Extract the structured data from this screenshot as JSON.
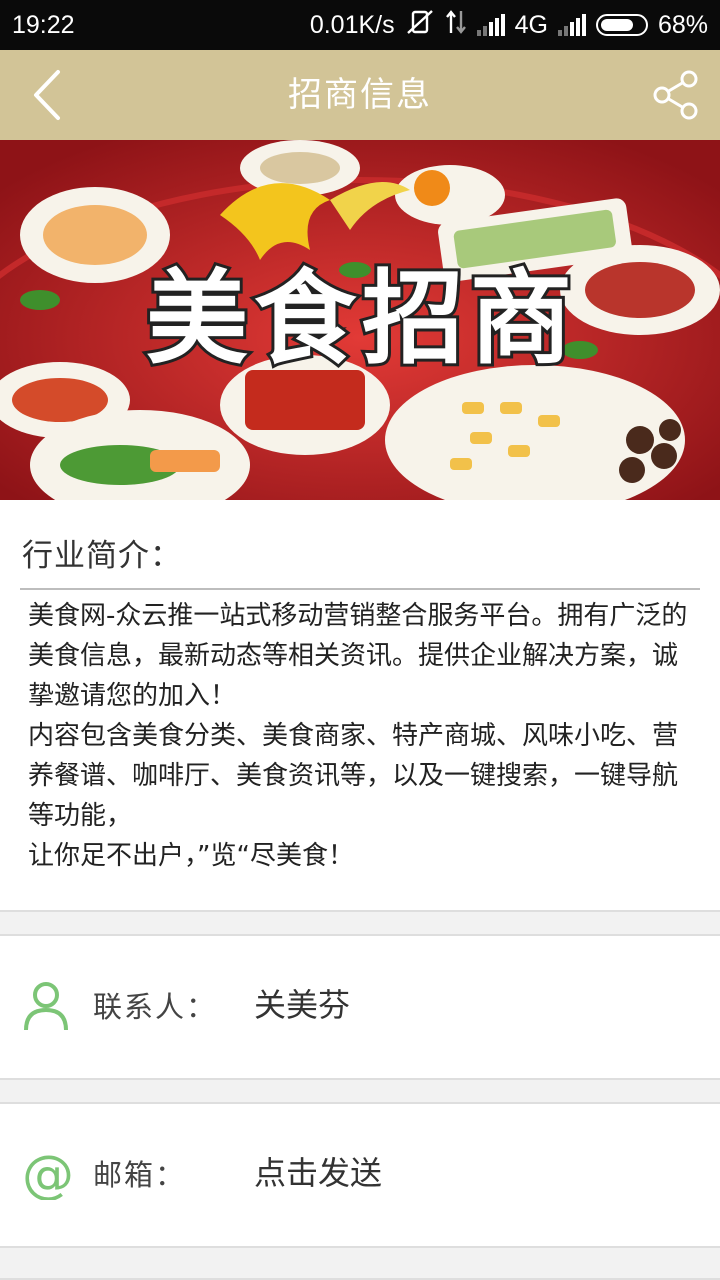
{
  "status_bar": {
    "time": "19:22",
    "network_speed": "0.01K/s",
    "network_type": "4G",
    "battery_percent": "68%",
    "battery_level": 0.68,
    "icons": [
      "mute-icon",
      "data-arrows-icon",
      "signal-icon",
      "signal-icon",
      "battery-icon"
    ]
  },
  "app_bar": {
    "title": "招商信息",
    "background": "#d2c497",
    "left_icon": "back-chevron-icon",
    "right_icon": "share-icon"
  },
  "banner": {
    "headline": "美食招商",
    "accent": "#b71e22"
  },
  "intro": {
    "heading": "行业简介：",
    "lines": [
      "美食网-众云推一站式移动营销整合服务平台。拥有广泛的美食信息，最新动态等相关资讯。提供企业解决方案，诚挚邀请您的加入！",
      "内容包含美食分类、美食商家、特产商城、风味小吃、营养餐谱、咖啡厅、美食资讯等，以及一键搜索，一键导航等功能，",
      "让你足不出户，”览“尽美食！"
    ]
  },
  "contact": {
    "label": "联系人：",
    "value": "关美芬",
    "icon": "person-icon",
    "icon_color": "#7cc576"
  },
  "email": {
    "label": "邮箱：",
    "value": "点击发送",
    "icon": "at-sign-icon",
    "icon_color": "#7cc576"
  }
}
